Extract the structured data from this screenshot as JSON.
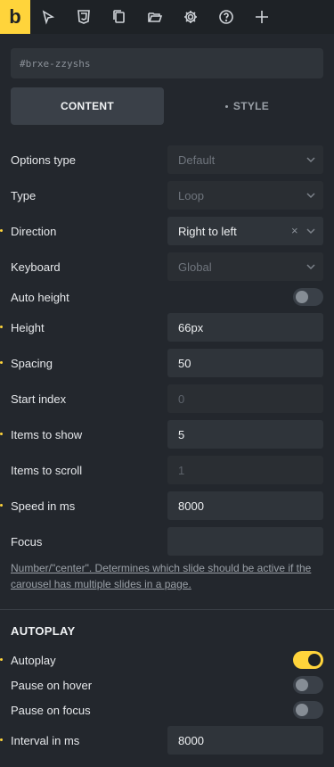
{
  "toolbar": {
    "logo": "b",
    "icons": [
      "cursor-icon",
      "css3-icon",
      "pages-icon",
      "folder-icon",
      "gear-icon",
      "help-icon",
      "plus-icon"
    ]
  },
  "element_id": "#brxe-zzyshs",
  "tabs": {
    "content": "CONTENT",
    "style": "STYLE"
  },
  "fields": {
    "options_type": {
      "label": "Options type",
      "value": "Default"
    },
    "type": {
      "label": "Type",
      "value": "Loop"
    },
    "direction": {
      "label": "Direction",
      "value": "Right to left"
    },
    "keyboard": {
      "label": "Keyboard",
      "value": "Global"
    },
    "auto_height": {
      "label": "Auto height",
      "on": false
    },
    "height": {
      "label": "Height",
      "value": "66px"
    },
    "spacing": {
      "label": "Spacing",
      "value": "50"
    },
    "start_index": {
      "label": "Start index",
      "placeholder": "0"
    },
    "items_to_show": {
      "label": "Items to show",
      "value": "5"
    },
    "items_to_scroll": {
      "label": "Items to scroll",
      "placeholder": "1"
    },
    "speed": {
      "label": "Speed in ms",
      "value": "8000"
    },
    "focus": {
      "label": "Focus",
      "value": ""
    },
    "focus_help": "Number/\"center\". Determines which slide should be active if the carousel has multiple slides in a page."
  },
  "autoplay": {
    "title": "AUTOPLAY",
    "autoplay": {
      "label": "Autoplay",
      "on": true
    },
    "pause_on_hover": {
      "label": "Pause on hover",
      "on": false
    },
    "pause_on_focus": {
      "label": "Pause on focus",
      "on": false
    },
    "interval": {
      "label": "Interval in ms",
      "value": "8000"
    }
  },
  "colors": {
    "accent": "#ffd43b",
    "background": "#23272d",
    "toolbar": "#1e2226"
  }
}
